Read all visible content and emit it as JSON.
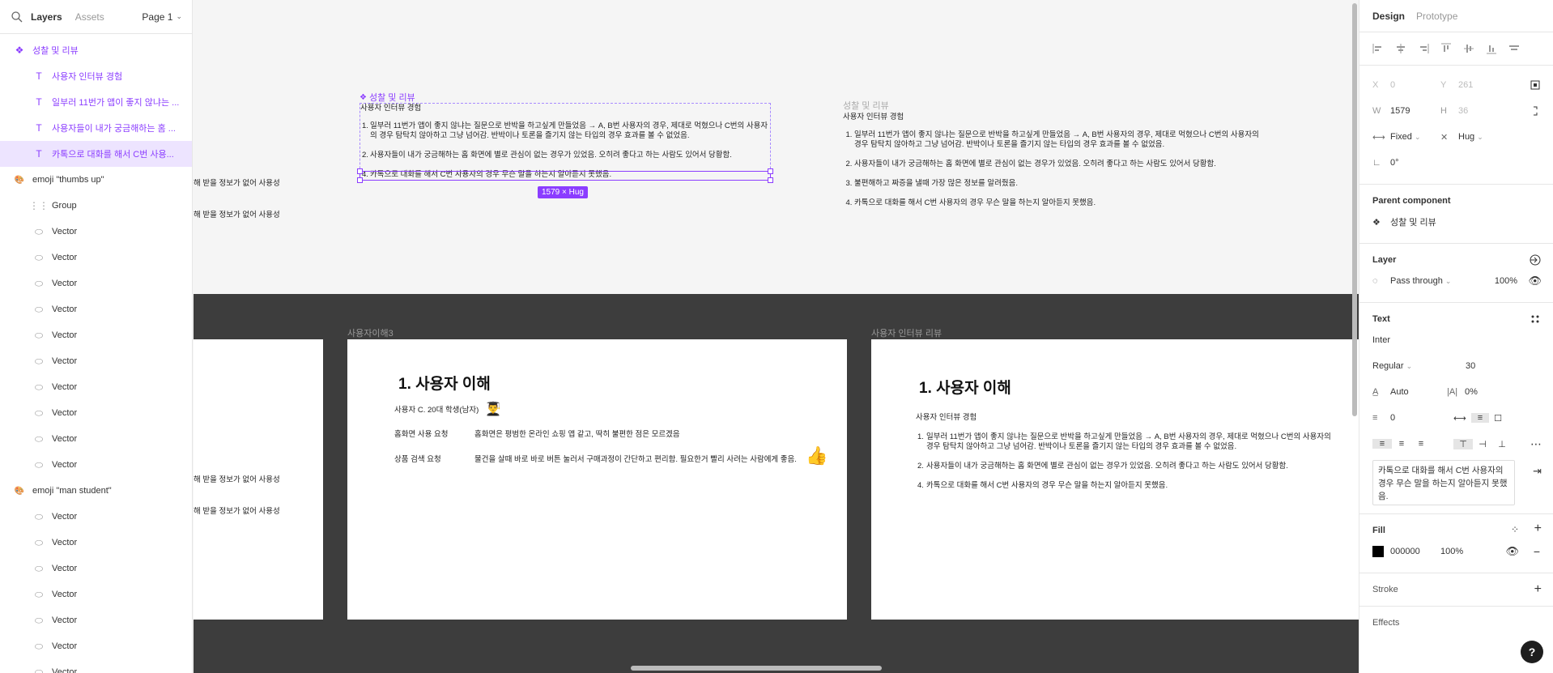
{
  "left_panel": {
    "tabs": [
      "Layers",
      "Assets"
    ],
    "page": "Page 1",
    "layers": [
      {
        "name": "성찰 및 리뷰",
        "type": "component",
        "indent": 0
      },
      {
        "name": "사용자 인터뷰 경험",
        "type": "text",
        "indent": 1
      },
      {
        "name": "일부러 11번가 앱이 좋지 않냐는 ...",
        "type": "text",
        "indent": 1
      },
      {
        "name": "사용자들이 내가 궁금해하는 홈 ...",
        "type": "text",
        "indent": 1
      },
      {
        "name": "카톡으로 대화를 해서 C번 사용...",
        "type": "text",
        "indent": 1,
        "selected": true
      },
      {
        "name": "emoji \"thumbs up\"",
        "type": "emoji-group",
        "indent": 0
      },
      {
        "name": "Group",
        "type": "group",
        "indent": 1
      },
      {
        "name": "Vector",
        "type": "vector",
        "indent": 1
      },
      {
        "name": "Vector",
        "type": "vector",
        "indent": 1
      },
      {
        "name": "Vector",
        "type": "vector",
        "indent": 1
      },
      {
        "name": "Vector",
        "type": "vector",
        "indent": 1
      },
      {
        "name": "Vector",
        "type": "vector",
        "indent": 1
      },
      {
        "name": "Vector",
        "type": "vector",
        "indent": 1
      },
      {
        "name": "Vector",
        "type": "vector",
        "indent": 1
      },
      {
        "name": "Vector",
        "type": "vector",
        "indent": 1
      },
      {
        "name": "Vector",
        "type": "vector",
        "indent": 1
      },
      {
        "name": "Vector",
        "type": "vector",
        "indent": 1
      },
      {
        "name": "emoji \"man student\"",
        "type": "emoji-group",
        "indent": 0
      },
      {
        "name": "Vector",
        "type": "vector",
        "indent": 1
      },
      {
        "name": "Vector",
        "type": "vector",
        "indent": 1
      },
      {
        "name": "Vector",
        "type": "vector",
        "indent": 1
      },
      {
        "name": "Vector",
        "type": "vector",
        "indent": 1
      },
      {
        "name": "Vector",
        "type": "vector",
        "indent": 1
      },
      {
        "name": "Vector",
        "type": "vector",
        "indent": 1
      },
      {
        "name": "Vector",
        "type": "vector",
        "indent": 1
      }
    ]
  },
  "canvas": {
    "partial_text_1": "해 받을 정보가 없어 사용성",
    "partial_text_2": "해 받을 정보가 없어 사용성",
    "selected_component": {
      "label": "성찰 및 리뷰",
      "heading": "사용자 인터뷰 경험",
      "items": [
        "일부러 11번가 앱이 좋지 않냐는 질문으로 반박을 하고싶게 만들었음 → A, B번 사용자의 경우, 제대로 먹혔으나 C번의 사용자의 경우 탐탁치 않아하고 그냥 넘어감. 반박이나 토론을 즐기지 않는 타입의 경우 효과를 볼 수 없었음.",
        "사용자들이 내가 궁금해하는 홈 화면에 별로 관심이 없는 경우가 있었음. 오히려 좋다고 하는 사람도 있어서 당황함.",
        "카톡으로 대화를 해서 C번 사용자의 경우 무슨 말을 하는지 알아듣지 못했음."
      ],
      "item_numbers": [
        "1.",
        "2.",
        "4."
      ],
      "size_badge": "1579 × Hug"
    },
    "main_component": {
      "label": "성찰 및 리뷰",
      "heading": "사용자 인터뷰 경험",
      "items": [
        "일부러 11번가 앱이 좋지 않냐는 질문으로 반박을 하고싶게 만들었음 → A, B번 사용자의 경우, 제대로 먹혔으나 C번의 사용자의 경우 탐탁치 않아하고 그냥 넘어감. 반박이나 토론을 즐기지 않는 타입의 경우 효과를 볼 수 없었음.",
        "사용자들이 내가 궁금해하는 홈 화면에 별로 관심이 없는 경우가 있었음. 오히려 좋다고 하는 사람도 있어서 당황함.",
        "불편해하고 짜증을 낼때 가장 많은 정보를 알려줬음.",
        "카톡으로 대화를 해서 C번 사용자의 경우 무슨 말을 하는지 알아듣지 못했음."
      ]
    },
    "left_frame": {
      "partial_text_1": "해 받을 정보가 없어 사용성",
      "partial_text_2": "해 받을 정보가 없어 사용성"
    },
    "frame_understanding": {
      "label": "사용자이해3",
      "title": "1. 사용자 이해",
      "user": "사용자 C. 20대 학생(남자)",
      "user_emoji": "👨‍🎓",
      "rows": [
        {
          "key": "홈화면 사용 요청",
          "value": "홈화면은 평범한 온라인 쇼핑 앱 같고, 딱히 불편한 점은 모르겠음"
        },
        {
          "key": "상품 검색 요청",
          "value": "물건을 살때 바로 바로 버튼 눌러서 구매과정이 간단하고 편리함. 필요한거 빨리 사려는 사람에게 좋음."
        }
      ],
      "thumbs_emoji": "👍"
    },
    "frame_review": {
      "label": "사용자 인터뷰 리뷰",
      "title": "1. 사용자 이해",
      "heading": "사용자 인터뷰 경험",
      "items": [
        "일부러 11번가 앱이 좋지 않냐는 질문으로 반박을 하고싶게 만들었음 → A, B번 사용자의 경우, 제대로 먹혔으나 C번의 사용자의 경우 탐탁치 않아하고 그냥 넘어감. 반박이나 토론을 즐기지 않는 타입의 경우 효과를 볼 수 없었음.",
        "사용자들이 내가 궁금해하는 홈 화면에 별로 관심이 없는 경우가 있었음. 오히려 좋다고 하는 사람도 있어서 당황함.",
        "카톡으로 대화를 해서 C번 사용자의 경우 무슨 말을 하는지 알아듣지 못했음."
      ],
      "item_numbers": [
        "1.",
        "2.",
        "4."
      ]
    }
  },
  "right_panel": {
    "tabs": [
      "Design",
      "Prototype"
    ],
    "x_label": "X",
    "x_value": "0",
    "y_label": "Y",
    "y_value": "261",
    "w_label": "W",
    "w_value": "1579",
    "h_label": "H",
    "h_value": "36",
    "width_mode": "Fixed",
    "height_mode": "Hug",
    "rotation": "0°",
    "parent_component_title": "Parent component",
    "parent_component_name": "성찰 및 리뷰",
    "layer_title": "Layer",
    "blend_mode": "Pass through",
    "layer_opacity": "100%",
    "text_title": "Text",
    "font_family": "Inter",
    "font_weight": "Regular",
    "font_size": "30",
    "line_height": "Auto",
    "letter_spacing": "0%",
    "paragraph_spacing": "0",
    "text_content": "카톡으로 대화를 해서 C번 사용자의 경우 무슨 말을 하는지 알아듣지 못했음.",
    "fill_title": "Fill",
    "fill_hex": "000000",
    "fill_opacity": "100%",
    "stroke_title": "Stroke",
    "effects_title": "Effects",
    "help": "?"
  },
  "colors": {
    "accent": "#8b3dff",
    "selection_bg": "#ede4ff",
    "dark_band": "#3d3d3d"
  }
}
